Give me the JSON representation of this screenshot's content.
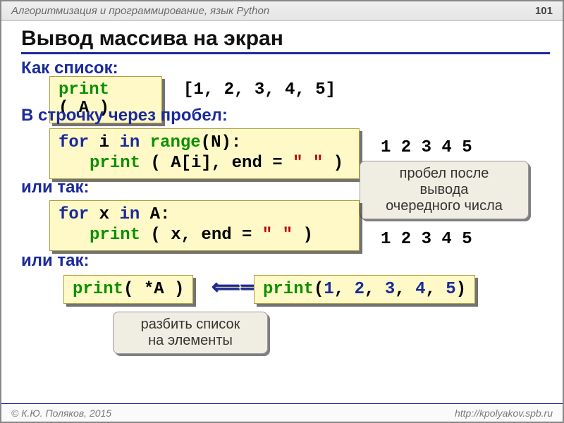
{
  "header": {
    "course": "Алгоритмизация и программирование, язык Python",
    "page": "101"
  },
  "title": "Вывод массива на экран",
  "sections": {
    "s1": "Как список:",
    "s2": "В строчку через пробел:",
    "s3": "или так:",
    "s4": "или так:"
  },
  "code1": {
    "print": "print",
    "arg": "( A )"
  },
  "out1": "[1, 2, 3, 4, 5]",
  "code2": {
    "l1": {
      "for": "for",
      "i": " i ",
      "in": "in",
      "range": " range",
      "tail": "(N):"
    },
    "l2": {
      "print": "print",
      "mid": " ( A[i], end = ",
      "q1": "\"",
      "sp": " ",
      "q2": "\"",
      "close": " )"
    }
  },
  "out2": "1 2 3 4 5",
  "callout1": "пробел после\nвывода\nочередного числа",
  "code3": {
    "l1": {
      "for": "for",
      "x": " x ",
      "in": "in",
      "A": " A:"
    },
    "l2": {
      "print": "print",
      "mid": " ( x, end = ",
      "q1": "\"",
      "sp": " ",
      "q2": "\"",
      "close": " )"
    }
  },
  "out3": "1 2 3 4 5",
  "code4a": {
    "print": "print",
    "arg": "( *A )"
  },
  "code4b": {
    "print": "print",
    "open": "(",
    "v1": "1",
    "v2": "2",
    "v3": "3",
    "v4": "4",
    "v5": "5",
    "c": ", ",
    "close": ")"
  },
  "callout2": "разбить список\nна элементы",
  "bidir": "⟸⟹",
  "footer": {
    "copyright": "© К.Ю. Поляков, 2015",
    "url": "http://kpolyakov.spb.ru"
  }
}
